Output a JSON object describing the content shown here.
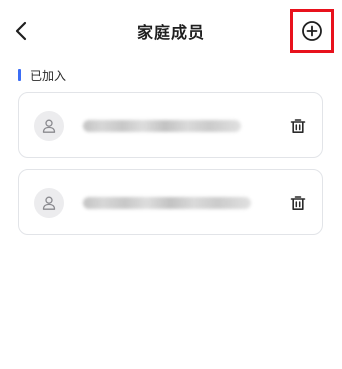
{
  "header": {
    "title": "家庭成员",
    "back_icon": "chevron-left-icon",
    "add_icon": "plus-circle-icon",
    "highlight_color": "#e8111c"
  },
  "section": {
    "label": "已加入",
    "accent_color": "#3b6df5"
  },
  "members": [
    {
      "avatar_icon": "user-icon",
      "name": "",
      "delete_icon": "trash-icon"
    },
    {
      "avatar_icon": "user-icon",
      "name": "",
      "delete_icon": "trash-icon"
    }
  ]
}
